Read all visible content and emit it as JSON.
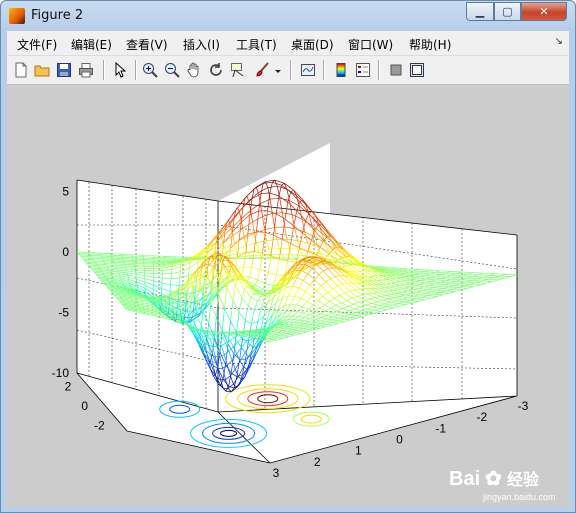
{
  "window": {
    "title": "Figure 2"
  },
  "menu": [
    {
      "label": "文件(F)"
    },
    {
      "label": "编辑(E)"
    },
    {
      "label": "查看(V)"
    },
    {
      "label": "插入(I)"
    },
    {
      "label": "工具(T)"
    },
    {
      "label": "桌面(D)"
    },
    {
      "label": "窗口(W)"
    },
    {
      "label": "帮助(H)"
    }
  ],
  "toolbar_icons": [
    "new-figure",
    "open-file",
    "save",
    "print",
    "select-arrow",
    "zoom-in",
    "zoom-out",
    "pan",
    "rotate-3d",
    "data-cursor",
    "brush",
    "link-plot",
    "colorbar",
    "legend",
    "hide-plot-tools",
    "show-plot-tools"
  ],
  "watermark": {
    "brand": "Bai",
    "brand_cn": "经验",
    "url": "jingyan.baidu.com"
  },
  "chart_data": {
    "type": "surface",
    "function": "peaks",
    "z_ticks": [
      "5",
      "0",
      "-5",
      "-10"
    ],
    "y_ticks": [
      "2",
      "0",
      "-2"
    ],
    "x_ticks": [
      "-3",
      "-2",
      "-1",
      "0",
      "1",
      "2",
      "3"
    ],
    "zlim": [
      -10,
      8
    ],
    "xlim": [
      -3,
      3
    ],
    "ylim": [
      -3,
      3
    ],
    "grid": true,
    "colormap": "jet",
    "contour_below": true
  }
}
